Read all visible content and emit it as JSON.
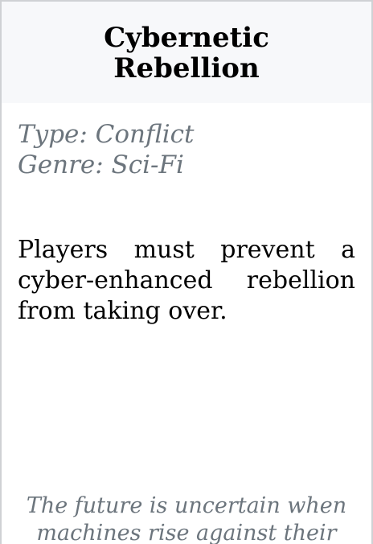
{
  "card": {
    "title": "Cybernetic Rebellion",
    "type_line": "Type: Conflict",
    "genre_line": "Genre: Sci-Fi",
    "description": "Players must prevent a cyber-enhanced rebellion from taking over.",
    "flavor_text": "The future is uncertain when machines rise against their"
  }
}
